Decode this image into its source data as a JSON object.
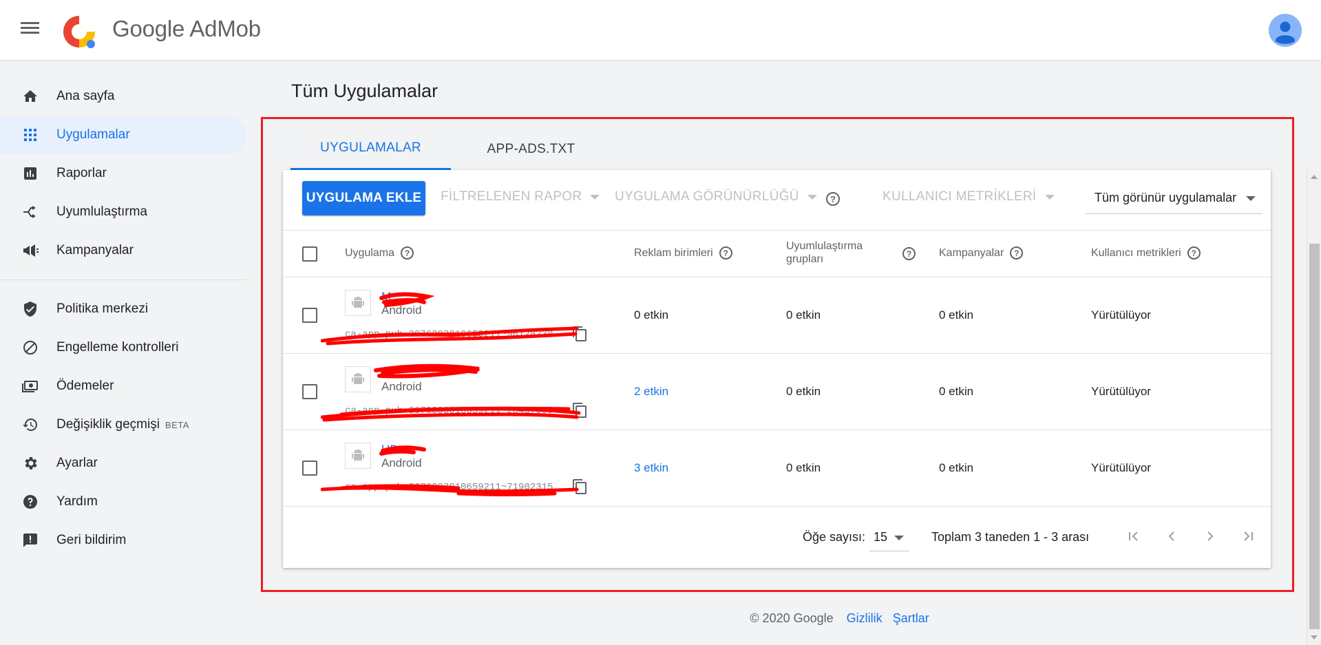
{
  "header": {
    "logo_google": "Google",
    "logo_product": "AdMob"
  },
  "sidebar": {
    "items": [
      {
        "label": "Ana sayfa",
        "icon": "home-icon"
      },
      {
        "label": "Uygulamalar",
        "icon": "apps-icon",
        "active": true
      },
      {
        "label": "Raporlar",
        "icon": "reports-icon"
      },
      {
        "label": "Uyumlulaştırma",
        "icon": "mediation-icon"
      },
      {
        "label": "Kampanyalar",
        "icon": "campaigns-icon"
      }
    ],
    "items2": [
      {
        "label": "Politika merkezi",
        "icon": "shield-icon"
      },
      {
        "label": "Engelleme kontrolleri",
        "icon": "block-icon"
      },
      {
        "label": "Ödemeler",
        "icon": "payments-icon"
      },
      {
        "label": "Değişiklik geçmişi",
        "icon": "history-icon",
        "badge": "BETA"
      },
      {
        "label": "Ayarlar",
        "icon": "gear-icon"
      },
      {
        "label": "Yardım",
        "icon": "help-icon"
      },
      {
        "label": "Geri bildirim",
        "icon": "feedback-icon"
      }
    ]
  },
  "main": {
    "title": "Tüm Uygulamalar",
    "tabs": [
      {
        "label": "UYGULAMALAR",
        "active": true
      },
      {
        "label": "APP-ADS.TXT",
        "active": false
      }
    ],
    "toolbar": {
      "add_button": "UYGULAMA EKLE",
      "filter_report": "FİLTRELENEN RAPOR",
      "app_visibility": "UYGULAMA GÖRÜNÜRLÜĞÜ",
      "user_metrics": "KULLANICI METRİKLERİ",
      "visible_apps": "Tüm görünür uygulamalar"
    },
    "columns": {
      "app": "Uygulama",
      "ad_units": "Reklam birimleri",
      "mediation_line1": "Uyumlulaştırma",
      "mediation_line2": "grupları",
      "campaigns": "Kampanyalar",
      "user_metrics": "Kullanıcı metrikleri"
    },
    "rows": [
      {
        "name": "M",
        "platform": "Android",
        "app_id": "ca-app-pub-3076303010659211~96128230",
        "ad_units": "0 etkin",
        "mediation": "0 etkin",
        "campaigns": "0 etkin",
        "metrics": "Yürütülüyor"
      },
      {
        "name": "",
        "platform": "Android",
        "app_id": "ca-app-pub-3076303010659211~28437009",
        "ad_units": "2 etkin",
        "mediation": "0 etkin",
        "campaigns": "0 etkin",
        "metrics": "Yürütülüyor"
      },
      {
        "name": "HD",
        "platform": "Android",
        "app_id": "ca-app-pub-3076303010659211~71902315",
        "ad_units": "3 etkin",
        "mediation": "0 etkin",
        "campaigns": "0 etkin",
        "metrics": "Yürütülüyor"
      }
    ],
    "pagination": {
      "items_label": "Öğe sayısı:",
      "items_value": "15",
      "range": "Toplam 3 taneden 1 - 3 arası"
    }
  },
  "footer": {
    "copyright": "© 2020 Google",
    "privacy": "Gizlilik",
    "terms": "Şartlar"
  },
  "colors": {
    "accent": "#1a73e8",
    "highlight_border": "#ee1c24",
    "redaction": "#ff0000"
  }
}
